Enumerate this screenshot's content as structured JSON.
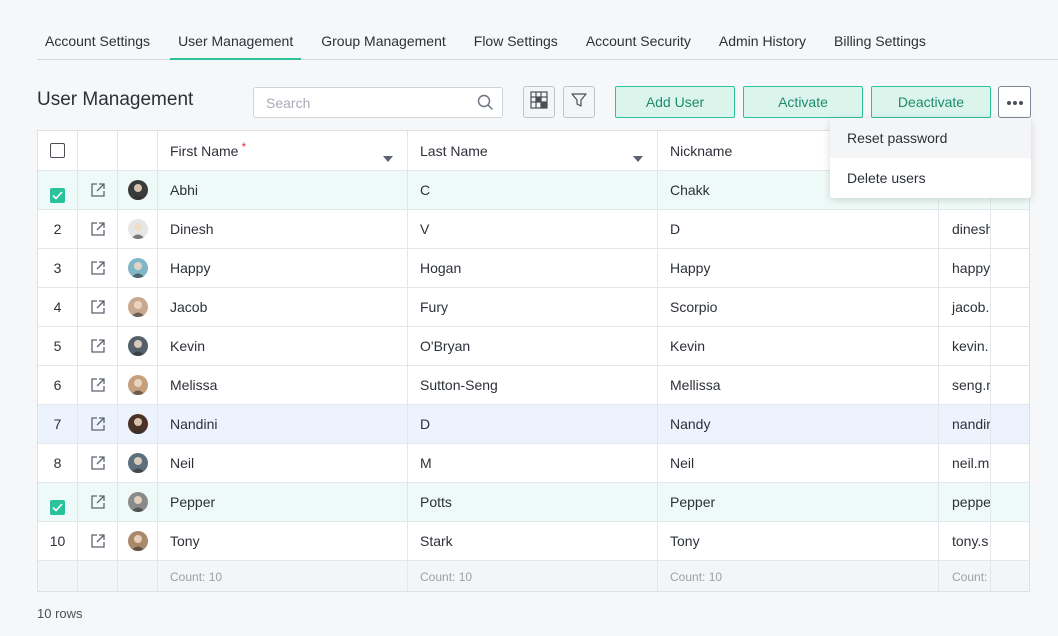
{
  "tabs": [
    "Account Settings",
    "User Management",
    "Group Management",
    "Flow Settings",
    "Account Security",
    "Admin History",
    "Billing Settings"
  ],
  "active_tab": "User Management",
  "page_title": "User Management",
  "search": {
    "placeholder": "Search"
  },
  "actions": {
    "add_user": "Add User",
    "activate": "Activate",
    "deactivate": "Deactivate"
  },
  "menu": {
    "reset_password": "Reset password",
    "delete_users": "Delete users"
  },
  "columns": {
    "first_name": "First Name",
    "required_mark": "*",
    "last_name": "Last Name",
    "nickname": "Nickname"
  },
  "rows": [
    {
      "index": "",
      "checked": true,
      "first": "Abhi",
      "last": "C",
      "nick": "Chakk",
      "email": "",
      "avatar": "dark"
    },
    {
      "index": "2",
      "checked": false,
      "first": "Dinesh",
      "last": "V",
      "nick": "D",
      "email": "dinesh",
      "avatar": "light"
    },
    {
      "index": "3",
      "checked": false,
      "first": "Happy",
      "last": "Hogan",
      "nick": "Happy",
      "email": "happy",
      "avatar": "teal"
    },
    {
      "index": "4",
      "checked": false,
      "first": "Jacob",
      "last": "Fury",
      "nick": "Scorpio",
      "email": "jacob.",
      "avatar": "skin"
    },
    {
      "index": "5",
      "checked": false,
      "first": "Kevin",
      "last": "O'Bryan",
      "nick": "Kevin",
      "email": "kevin.",
      "avatar": "slate"
    },
    {
      "index": "6",
      "checked": false,
      "first": "Melissa",
      "last": "Sutton-Seng",
      "nick": "Mellissa",
      "email": "seng.n",
      "avatar": "warm"
    },
    {
      "index": "7",
      "checked": false,
      "first": "Nandini",
      "last": "D",
      "nick": "Nandy",
      "email": "nandir",
      "avatar": "brown"
    },
    {
      "index": "8",
      "checked": false,
      "first": "Neil",
      "last": "M",
      "nick": "Neil",
      "email": "neil.m",
      "avatar": "steel"
    },
    {
      "index": "",
      "checked": true,
      "first": "Pepper",
      "last": "Potts",
      "nick": "Pepper",
      "email": "peppe",
      "avatar": "grey"
    },
    {
      "index": "10",
      "checked": false,
      "first": "Tony",
      "last": "Stark",
      "nick": "Tony",
      "email": "tony.s",
      "avatar": "tan"
    }
  ],
  "footer": {
    "count_first": "Count: 10",
    "count_last": "Count: 10",
    "count_nick": "Count: 10",
    "count_email": "Count:"
  },
  "rows_label": "10 rows",
  "colors": {
    "accent": "#2bc29b",
    "accent_bg": "#dbf5ec",
    "accent_text": "#1e8a6d",
    "selected_row": "#eefaf7",
    "hover_row": "#ecf3fd",
    "required": "#e2364b"
  },
  "icons": [
    "search-icon",
    "grid-view-icon",
    "filter-icon",
    "more-icon",
    "checkmark-icon",
    "open-external-icon",
    "sort-caret-icon"
  ]
}
